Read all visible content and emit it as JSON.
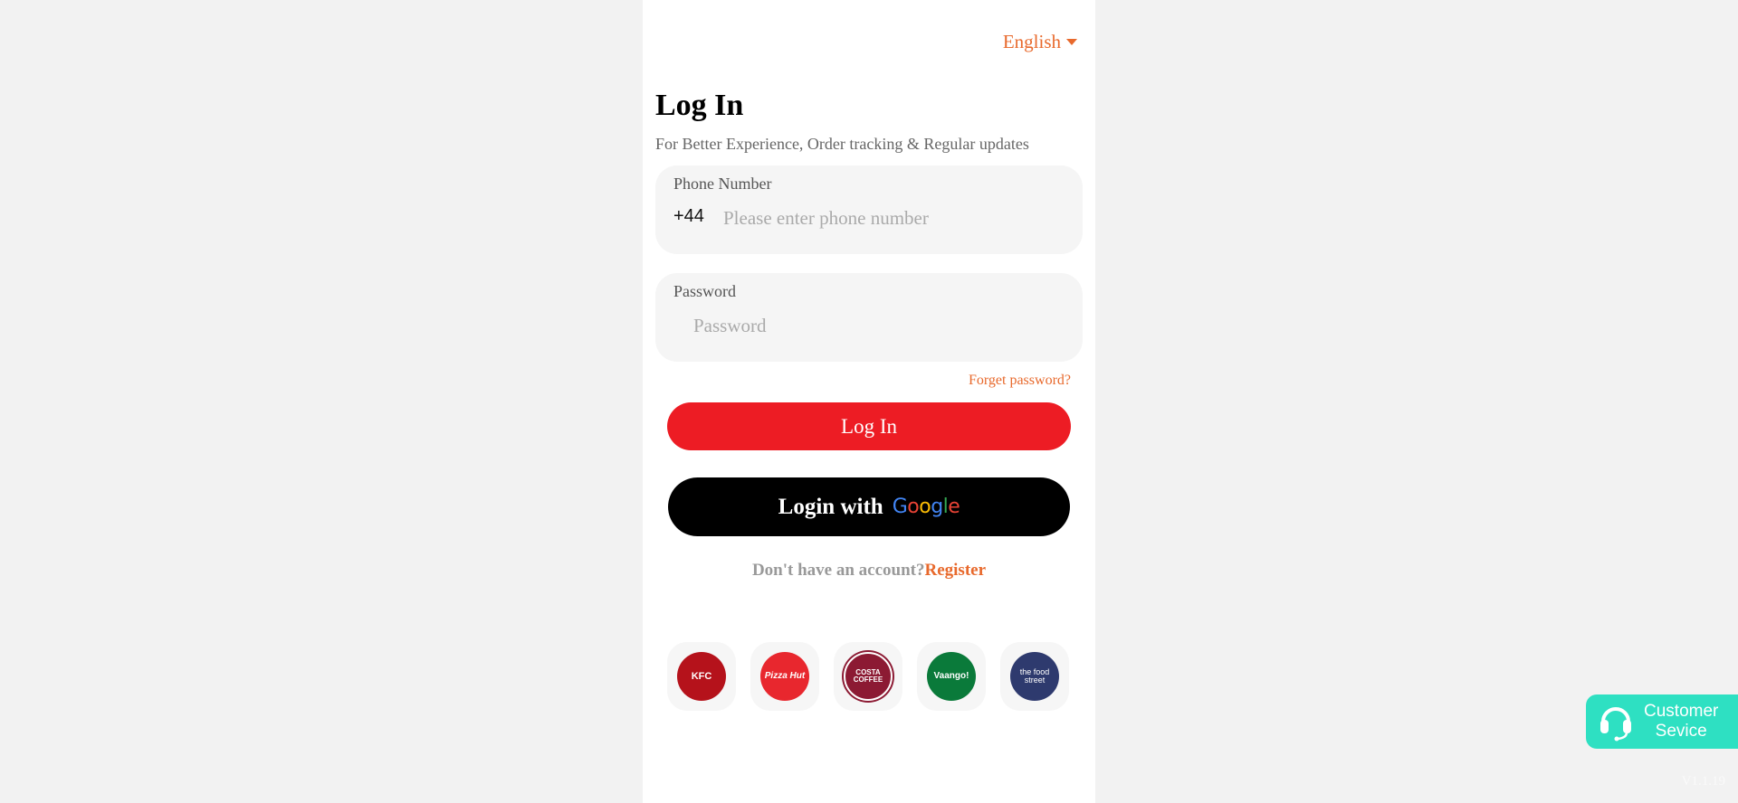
{
  "header": {
    "language": "English"
  },
  "login": {
    "title": "Log In",
    "subtitle": "For Better Experience, Order tracking & Regular updates",
    "phone_field": {
      "label": "Phone Number",
      "country_code": "+44",
      "value": "",
      "placeholder": "Please enter phone number"
    },
    "password_field": {
      "label": "Password",
      "value": "",
      "placeholder": "Password"
    },
    "forgot_password": "Forget password?",
    "login_button": "Log In",
    "google_button": {
      "label": "Login with",
      "brand_letters": [
        {
          "char": "G",
          "color": "#4285f4"
        },
        {
          "char": "o",
          "color": "#ea4335"
        },
        {
          "char": "o",
          "color": "#fbbc05"
        },
        {
          "char": "g",
          "color": "#4285f4"
        },
        {
          "char": "l",
          "color": "#34a853"
        },
        {
          "char": "e",
          "color": "#ea4335"
        }
      ]
    },
    "register_prompt": "Don't have an account?",
    "register_link": "Register"
  },
  "brands": [
    {
      "name": "KFC",
      "text": "KFC",
      "color": "#b5121b",
      "icon": "kfc-logo-icon"
    },
    {
      "name": "Pizza Hut",
      "text": "Pizza Hut",
      "color": "#e8272e",
      "icon": "pizza-hut-logo-icon"
    },
    {
      "name": "Costa Coffee",
      "text": "COSTA COFFEE",
      "color": "#8c1a33",
      "icon": "costa-coffee-logo-icon"
    },
    {
      "name": "Vaango",
      "text": "Vaango!",
      "color": "#0a7a3a",
      "icon": "vaango-logo-icon"
    },
    {
      "name": "The Food Street",
      "text": "the food street",
      "color": "#2e3a6e",
      "icon": "food-street-logo-icon"
    }
  ],
  "customer_service": {
    "label": "Customer Sevice",
    "icon": "headset-icon",
    "color": "#2ee0c2"
  },
  "version": "V1.1.19",
  "colors": {
    "accent": "#e8692c",
    "primary_button": "#ed1c24",
    "google_button": "#000000"
  }
}
